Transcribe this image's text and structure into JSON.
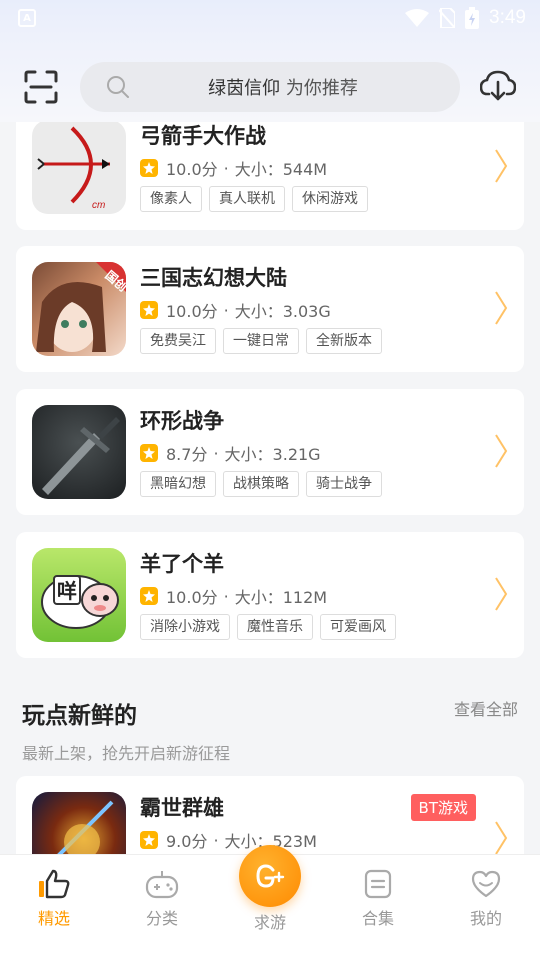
{
  "status": {
    "time": "3:49"
  },
  "search": {
    "keyword": "绿茵信仰",
    "hint": "为你推荐"
  },
  "games": [
    {
      "name": "弓箭手大作战",
      "score": "10.0分",
      "size": "大小：544M",
      "tags": [
        "像素人",
        "真人联机",
        "休闲游戏"
      ]
    },
    {
      "name": "三国志幻想大陆",
      "score": "10.0分",
      "size": "大小：3.03G",
      "tags": [
        "免费吴江",
        "一键日常",
        "全新版本"
      ]
    },
    {
      "name": "环形战争",
      "score": "8.7分",
      "size": "大小：3.21G",
      "tags": [
        "黑暗幻想",
        "战棋策略",
        "骑士战争"
      ]
    },
    {
      "name": "羊了个羊",
      "score": "10.0分",
      "size": "大小：112M",
      "tags": [
        "消除小游戏",
        "魔性音乐",
        "可爱画风"
      ]
    }
  ],
  "section": {
    "title": "玩点新鲜的",
    "more": "查看全部",
    "subtitle": "最新上架，抢先开启新游征程"
  },
  "new_game": {
    "name": "霸世群雄",
    "score": "9.0分",
    "size": "大小：523M",
    "badge": "BT游戏"
  },
  "thumb_labels": {
    "guochuang": "国创",
    "sheep": "咩"
  },
  "tabs": [
    {
      "label": "精选"
    },
    {
      "label": "分类"
    },
    {
      "label": "求游"
    },
    {
      "label": "合集"
    },
    {
      "label": "我的"
    }
  ],
  "colors": {
    "accent": "#ff9a00",
    "badge": "#ff5f5f",
    "star": "#ffb400"
  }
}
